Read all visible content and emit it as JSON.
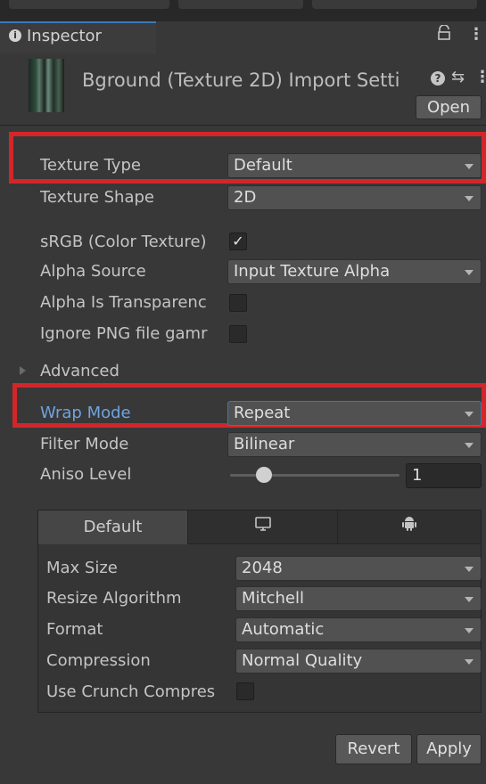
{
  "tab": {
    "title": "Inspector",
    "info_icon": "i",
    "lock_icon": "ᴀ",
    "menu_icon": "⋮"
  },
  "header": {
    "title": "Bground (Texture 2D) Import Setti",
    "help_icon": "❓",
    "preset_icon": "⇄",
    "menu_icon": "⋮",
    "open_label": "Open"
  },
  "fields": {
    "texture_type": {
      "label": "Texture Type",
      "value": "Default"
    },
    "texture_shape": {
      "label": "Texture Shape",
      "value": "2D"
    },
    "srgb": {
      "label": "sRGB (Color Texture)",
      "checked": true
    },
    "alpha_source": {
      "label": "Alpha Source",
      "value": "Input Texture Alpha"
    },
    "alpha_transparency": {
      "label": "Alpha Is Transparenc",
      "checked": false
    },
    "ignore_png": {
      "label": "Ignore PNG file gamr",
      "checked": false
    },
    "advanced": {
      "label": "Advanced"
    },
    "wrap_mode": {
      "label": "Wrap Mode",
      "value": "Repeat"
    },
    "filter_mode": {
      "label": "Filter Mode",
      "value": "Bilinear"
    },
    "aniso_level": {
      "label": "Aniso Level",
      "value": "1",
      "slider_fraction": 0.2
    }
  },
  "platform": {
    "tabs": [
      {
        "label": "Default"
      },
      {
        "icon": "monitor-icon"
      },
      {
        "icon": "android-icon"
      }
    ],
    "max_size": {
      "label": "Max Size",
      "value": "2048"
    },
    "resize": {
      "label": "Resize Algorithm",
      "value": "Mitchell"
    },
    "format": {
      "label": "Format",
      "value": "Automatic"
    },
    "compression": {
      "label": "Compression",
      "value": "Normal Quality"
    },
    "crunch": {
      "label": "Use Crunch Compres",
      "checked": false
    }
  },
  "actions": {
    "revert": "Revert",
    "apply": "Apply"
  },
  "colors": {
    "highlight": "#d3262b",
    "accent_blue": "#3a79bb",
    "wrap_label": "#6fa3e0"
  }
}
